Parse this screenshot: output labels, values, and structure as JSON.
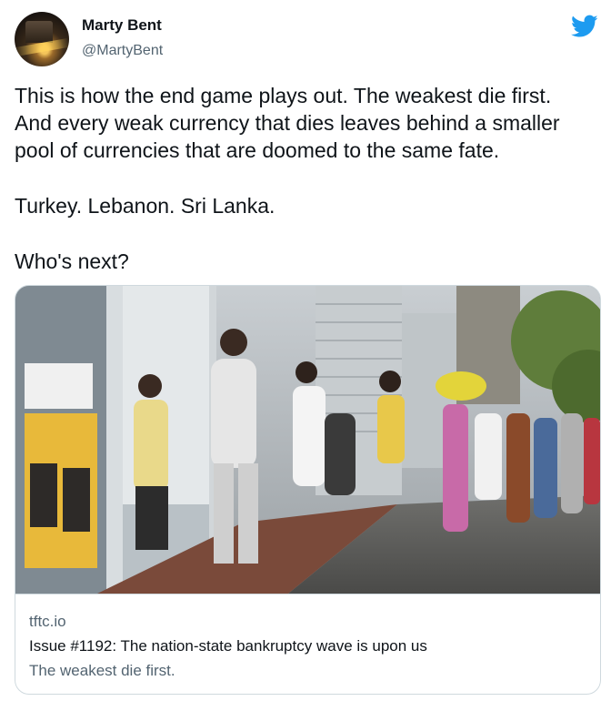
{
  "author": {
    "name": "Marty Bent",
    "handle": "@MartyBent"
  },
  "tweet": {
    "lines": [
      "This is how the end game plays out. The weakest die first.",
      "And every weak currency that dies leaves behind a smaller",
      "pool of currencies that are doomed to the same fate.",
      "Turkey. Lebanon. Sri Lanka.",
      "Who's next?"
    ]
  },
  "card": {
    "domain": "tftc.io",
    "title": "Issue #1192: The nation-state bankruptcy wave is upon us",
    "description": "The weakest die first."
  },
  "colors": {
    "twitter_blue": "#1d9bf0",
    "secondary_text": "#536471",
    "border": "#cfd9de"
  },
  "icons": {
    "brand": "twitter-bird-icon"
  }
}
